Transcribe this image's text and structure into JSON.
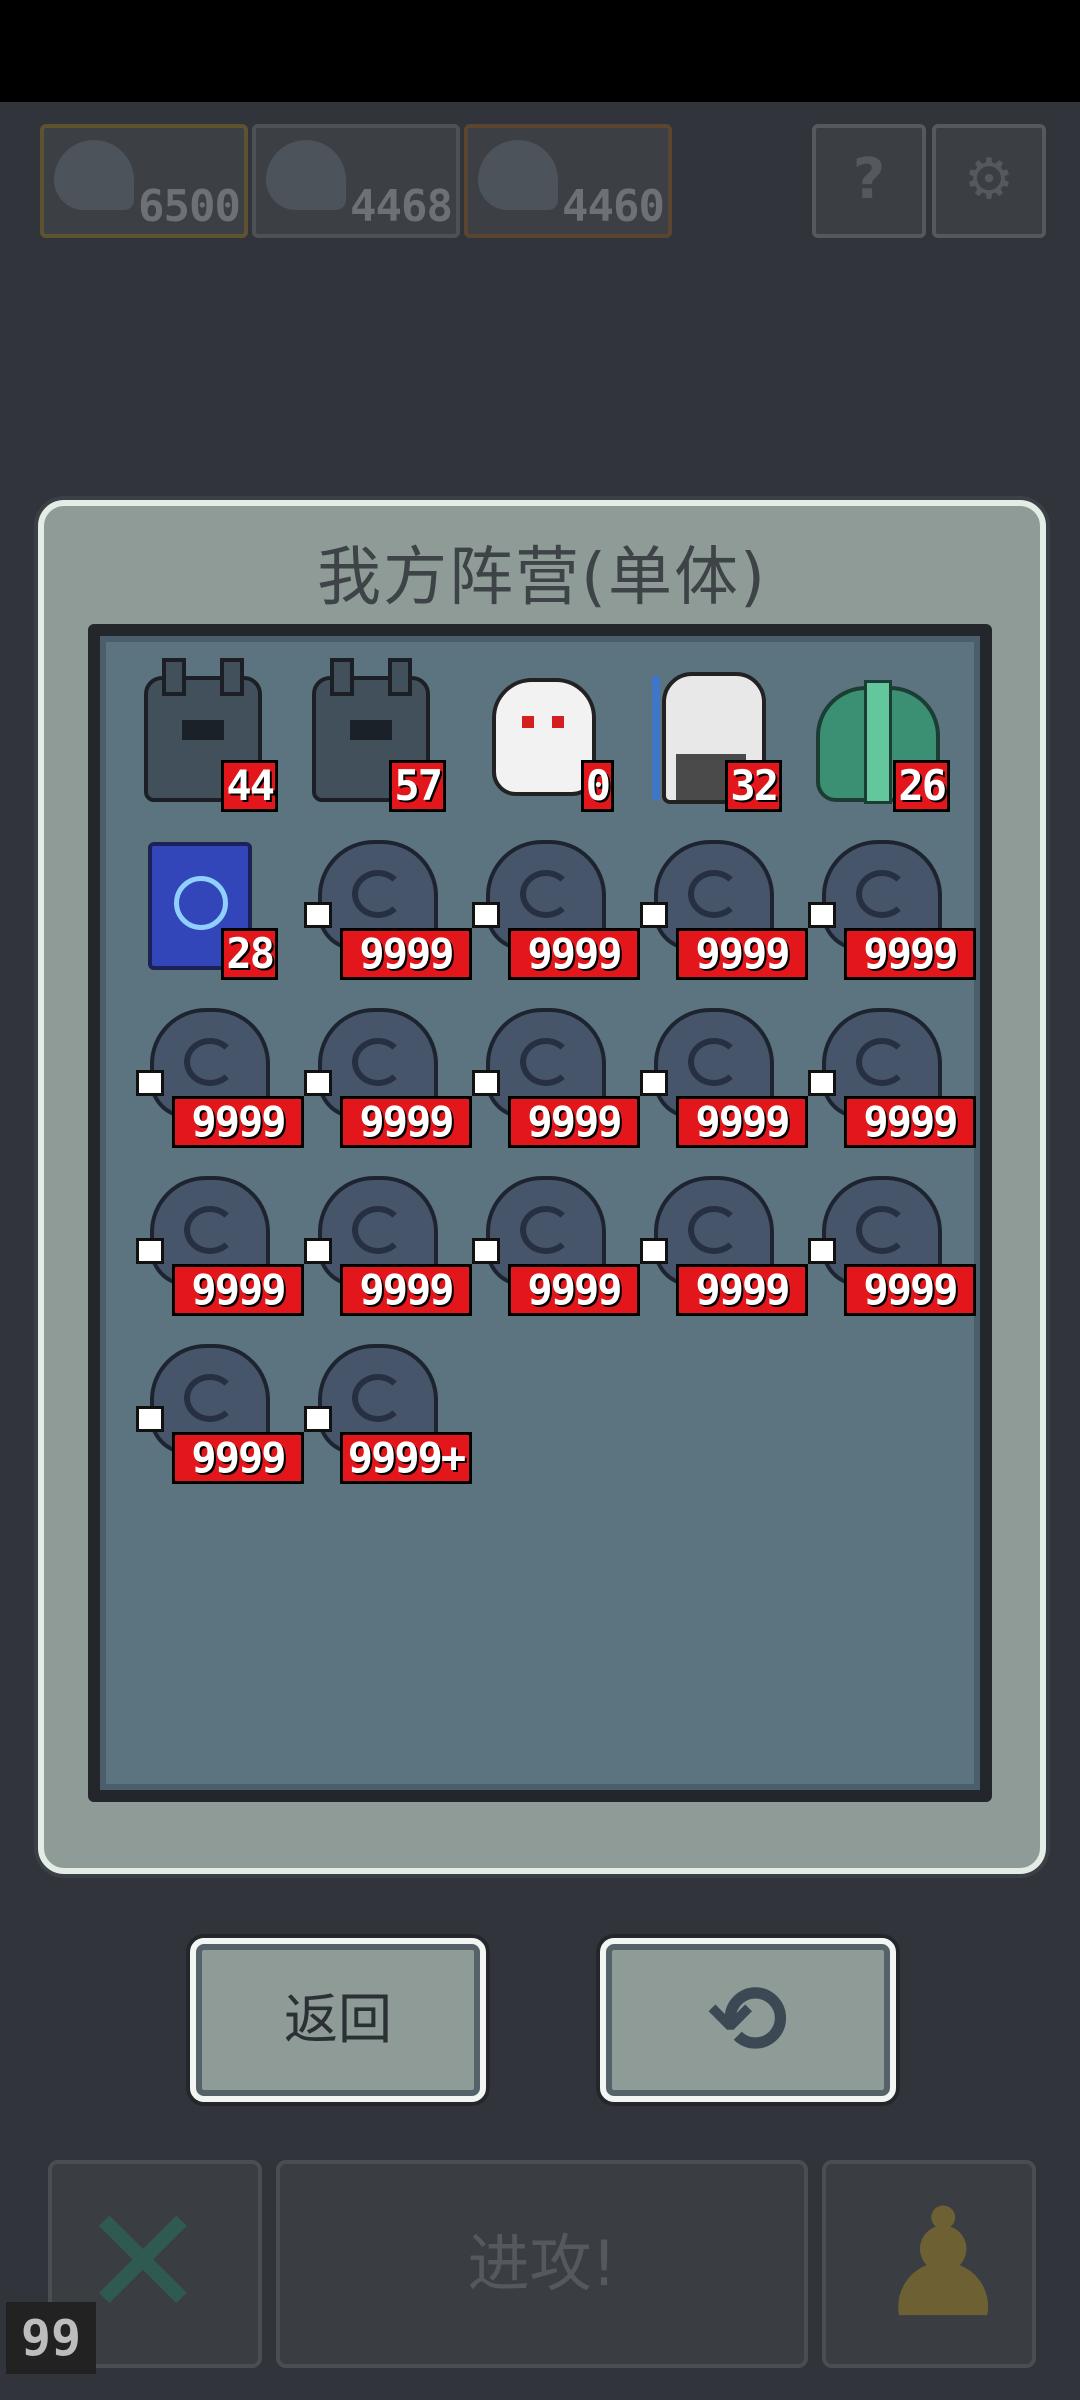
{
  "top_resources": [
    {
      "value": "6500"
    },
    {
      "value": "4468"
    },
    {
      "value": "4460"
    }
  ],
  "top_buttons": {
    "help_glyph": "?",
    "settings_glyph": "⚙"
  },
  "modal": {
    "title": "我方阵营(单体)",
    "units": [
      {
        "kind": "beast",
        "count": "44"
      },
      {
        "kind": "beast",
        "count": "57"
      },
      {
        "kind": "ghost",
        "count": "0"
      },
      {
        "kind": "sage",
        "count": "32"
      },
      {
        "kind": "slime",
        "count": "26"
      },
      {
        "kind": "clock",
        "count": "28"
      },
      {
        "kind": "wave",
        "count": "9999"
      },
      {
        "kind": "wave",
        "count": "9999"
      },
      {
        "kind": "wave",
        "count": "9999"
      },
      {
        "kind": "wave",
        "count": "9999"
      },
      {
        "kind": "wave",
        "count": "9999"
      },
      {
        "kind": "wave",
        "count": "9999"
      },
      {
        "kind": "wave",
        "count": "9999"
      },
      {
        "kind": "wave",
        "count": "9999"
      },
      {
        "kind": "wave",
        "count": "9999"
      },
      {
        "kind": "wave",
        "count": "9999"
      },
      {
        "kind": "wave",
        "count": "9999"
      },
      {
        "kind": "wave",
        "count": "9999"
      },
      {
        "kind": "wave",
        "count": "9999"
      },
      {
        "kind": "wave",
        "count": "9999"
      },
      {
        "kind": "wave",
        "count": "9999"
      },
      {
        "kind": "wave",
        "count": "9999+"
      }
    ]
  },
  "buttons": {
    "back_label": "返回",
    "refresh_glyph": "⟲"
  },
  "bottom_bar": {
    "attack_label": "进攻!",
    "cancel_glyph": "✕",
    "pawn_glyph": "♟"
  },
  "corner_counter": "99"
}
